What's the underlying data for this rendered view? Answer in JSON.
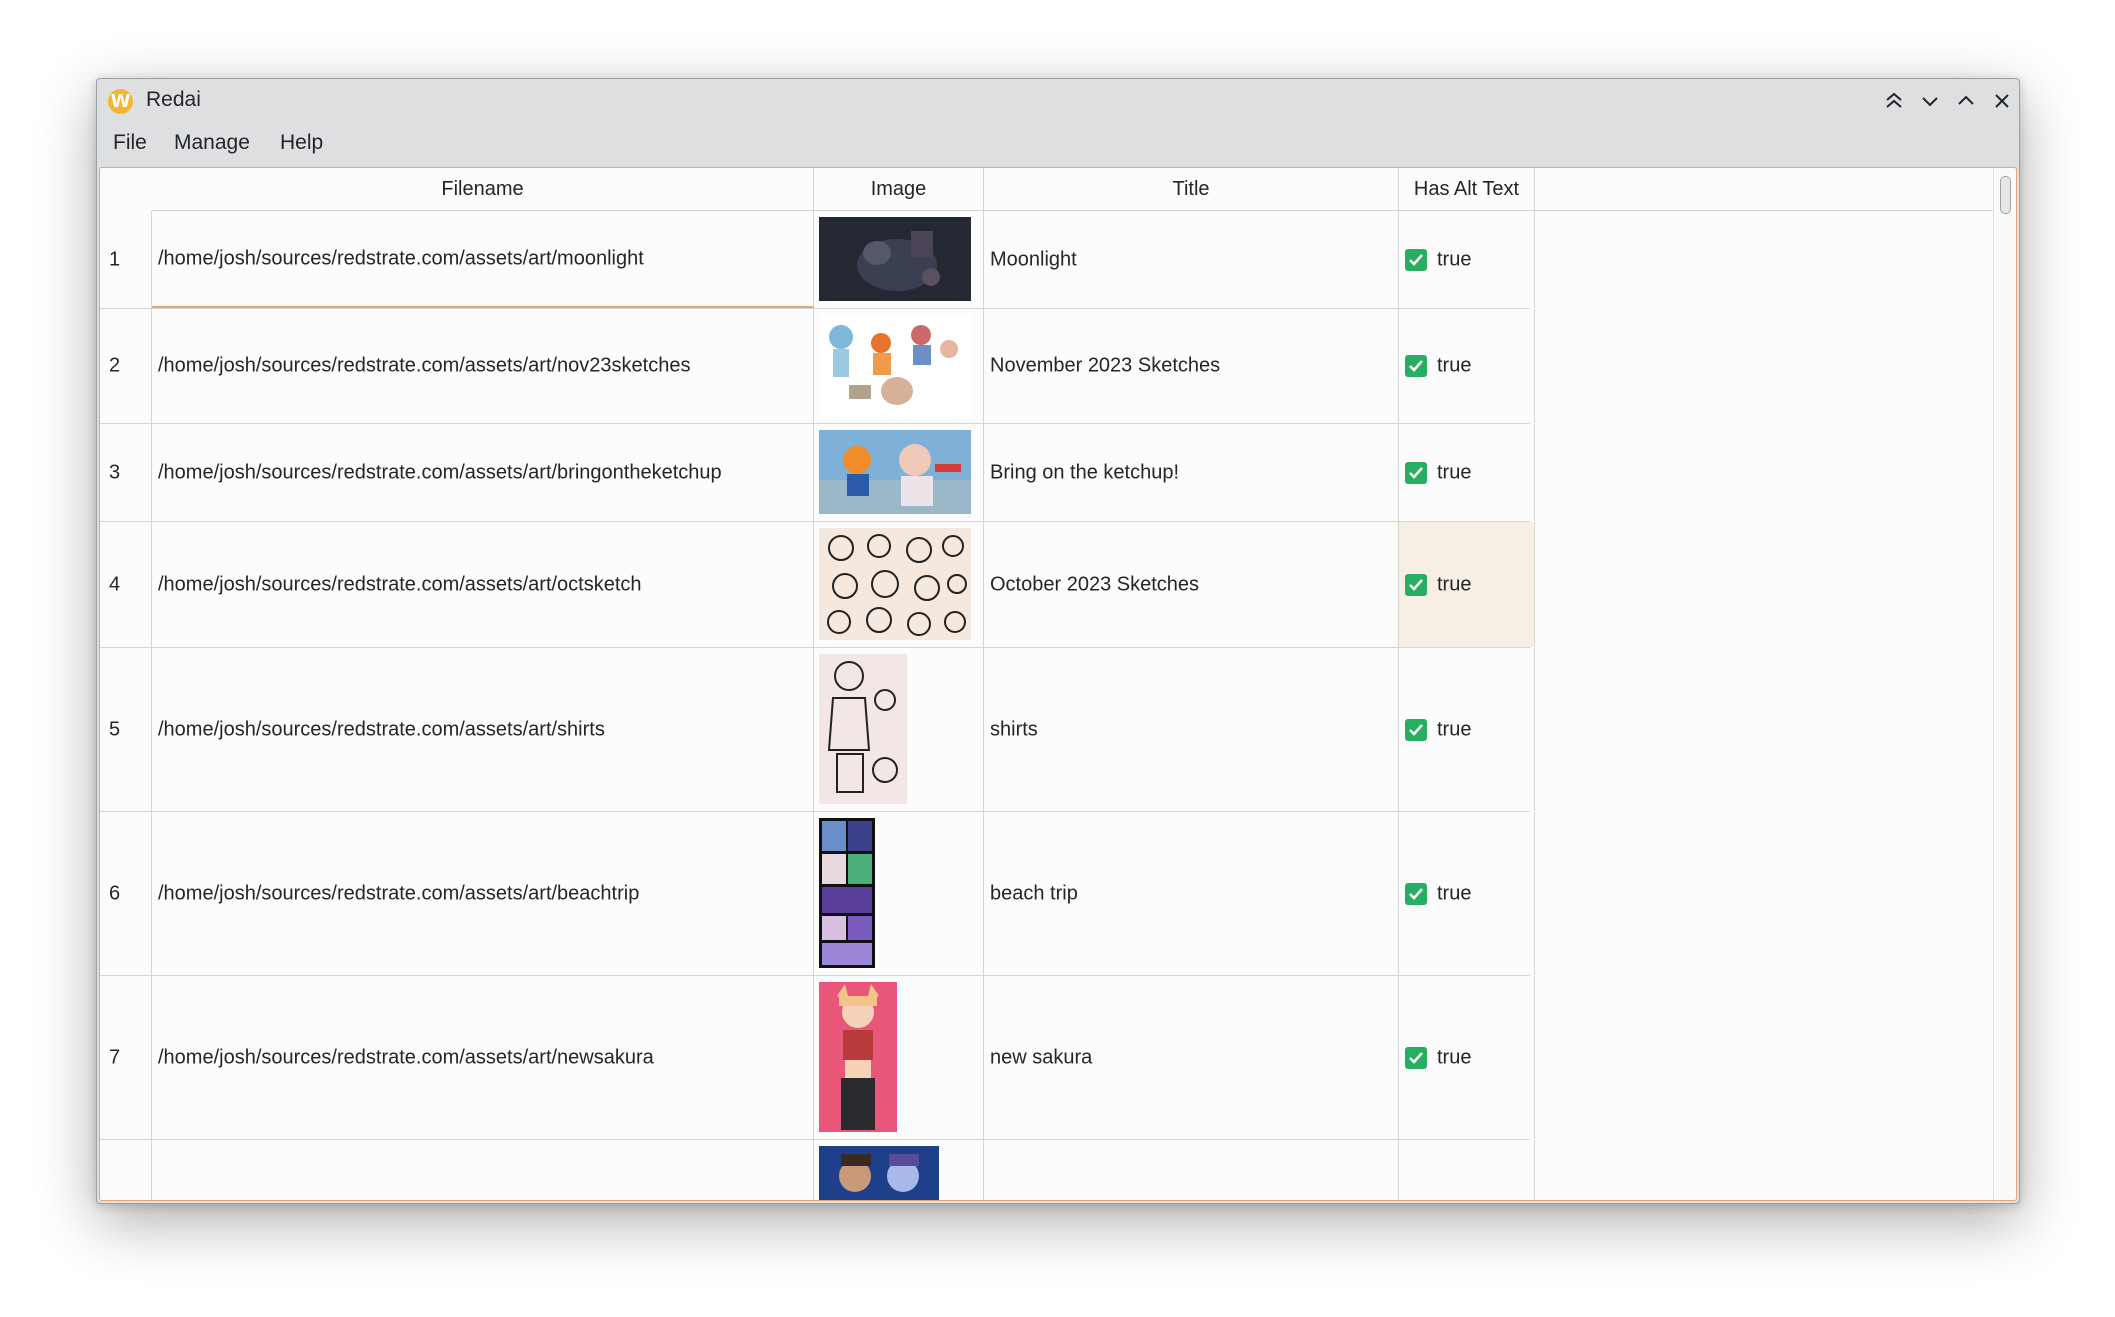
{
  "window": {
    "title": "Redai",
    "app_icon": "W"
  },
  "menu": [
    "File",
    "Manage",
    "Help"
  ],
  "table": {
    "headers": [
      "Filename",
      "Image",
      "Title",
      "Has Alt Text"
    ],
    "rows": [
      {
        "num": "1",
        "filename": "/home/josh/sources/redstrate.com/assets/art/moonlight",
        "title": "Moonlight",
        "alt": "true"
      },
      {
        "num": "2",
        "filename": "/home/josh/sources/redstrate.com/assets/art/nov23sketches",
        "title": "November 2023 Sketches",
        "alt": "true"
      },
      {
        "num": "3",
        "filename": "/home/josh/sources/redstrate.com/assets/art/bringontheketchup",
        "title": "Bring on the ketchup!",
        "alt": "true"
      },
      {
        "num": "4",
        "filename": "/home/josh/sources/redstrate.com/assets/art/octsketch",
        "title": "October 2023 Sketches",
        "alt": "true"
      },
      {
        "num": "5",
        "filename": "/home/josh/sources/redstrate.com/assets/art/shirts",
        "title": "shirts",
        "alt": "true"
      },
      {
        "num": "6",
        "filename": "/home/josh/sources/redstrate.com/assets/art/beachtrip",
        "title": "beach trip",
        "alt": "true"
      },
      {
        "num": "7",
        "filename": "/home/josh/sources/redstrate.com/assets/art/newsakura",
        "title": "new sakura",
        "alt": "true"
      }
    ]
  },
  "colors": {
    "accent": "#e0a878",
    "check": "#27ae60",
    "selection": "#f8efe4"
  },
  "icons": [
    "keep-above-icon",
    "minimize-icon",
    "maximize-icon",
    "close-icon",
    "checkbox-checked-icon"
  ]
}
